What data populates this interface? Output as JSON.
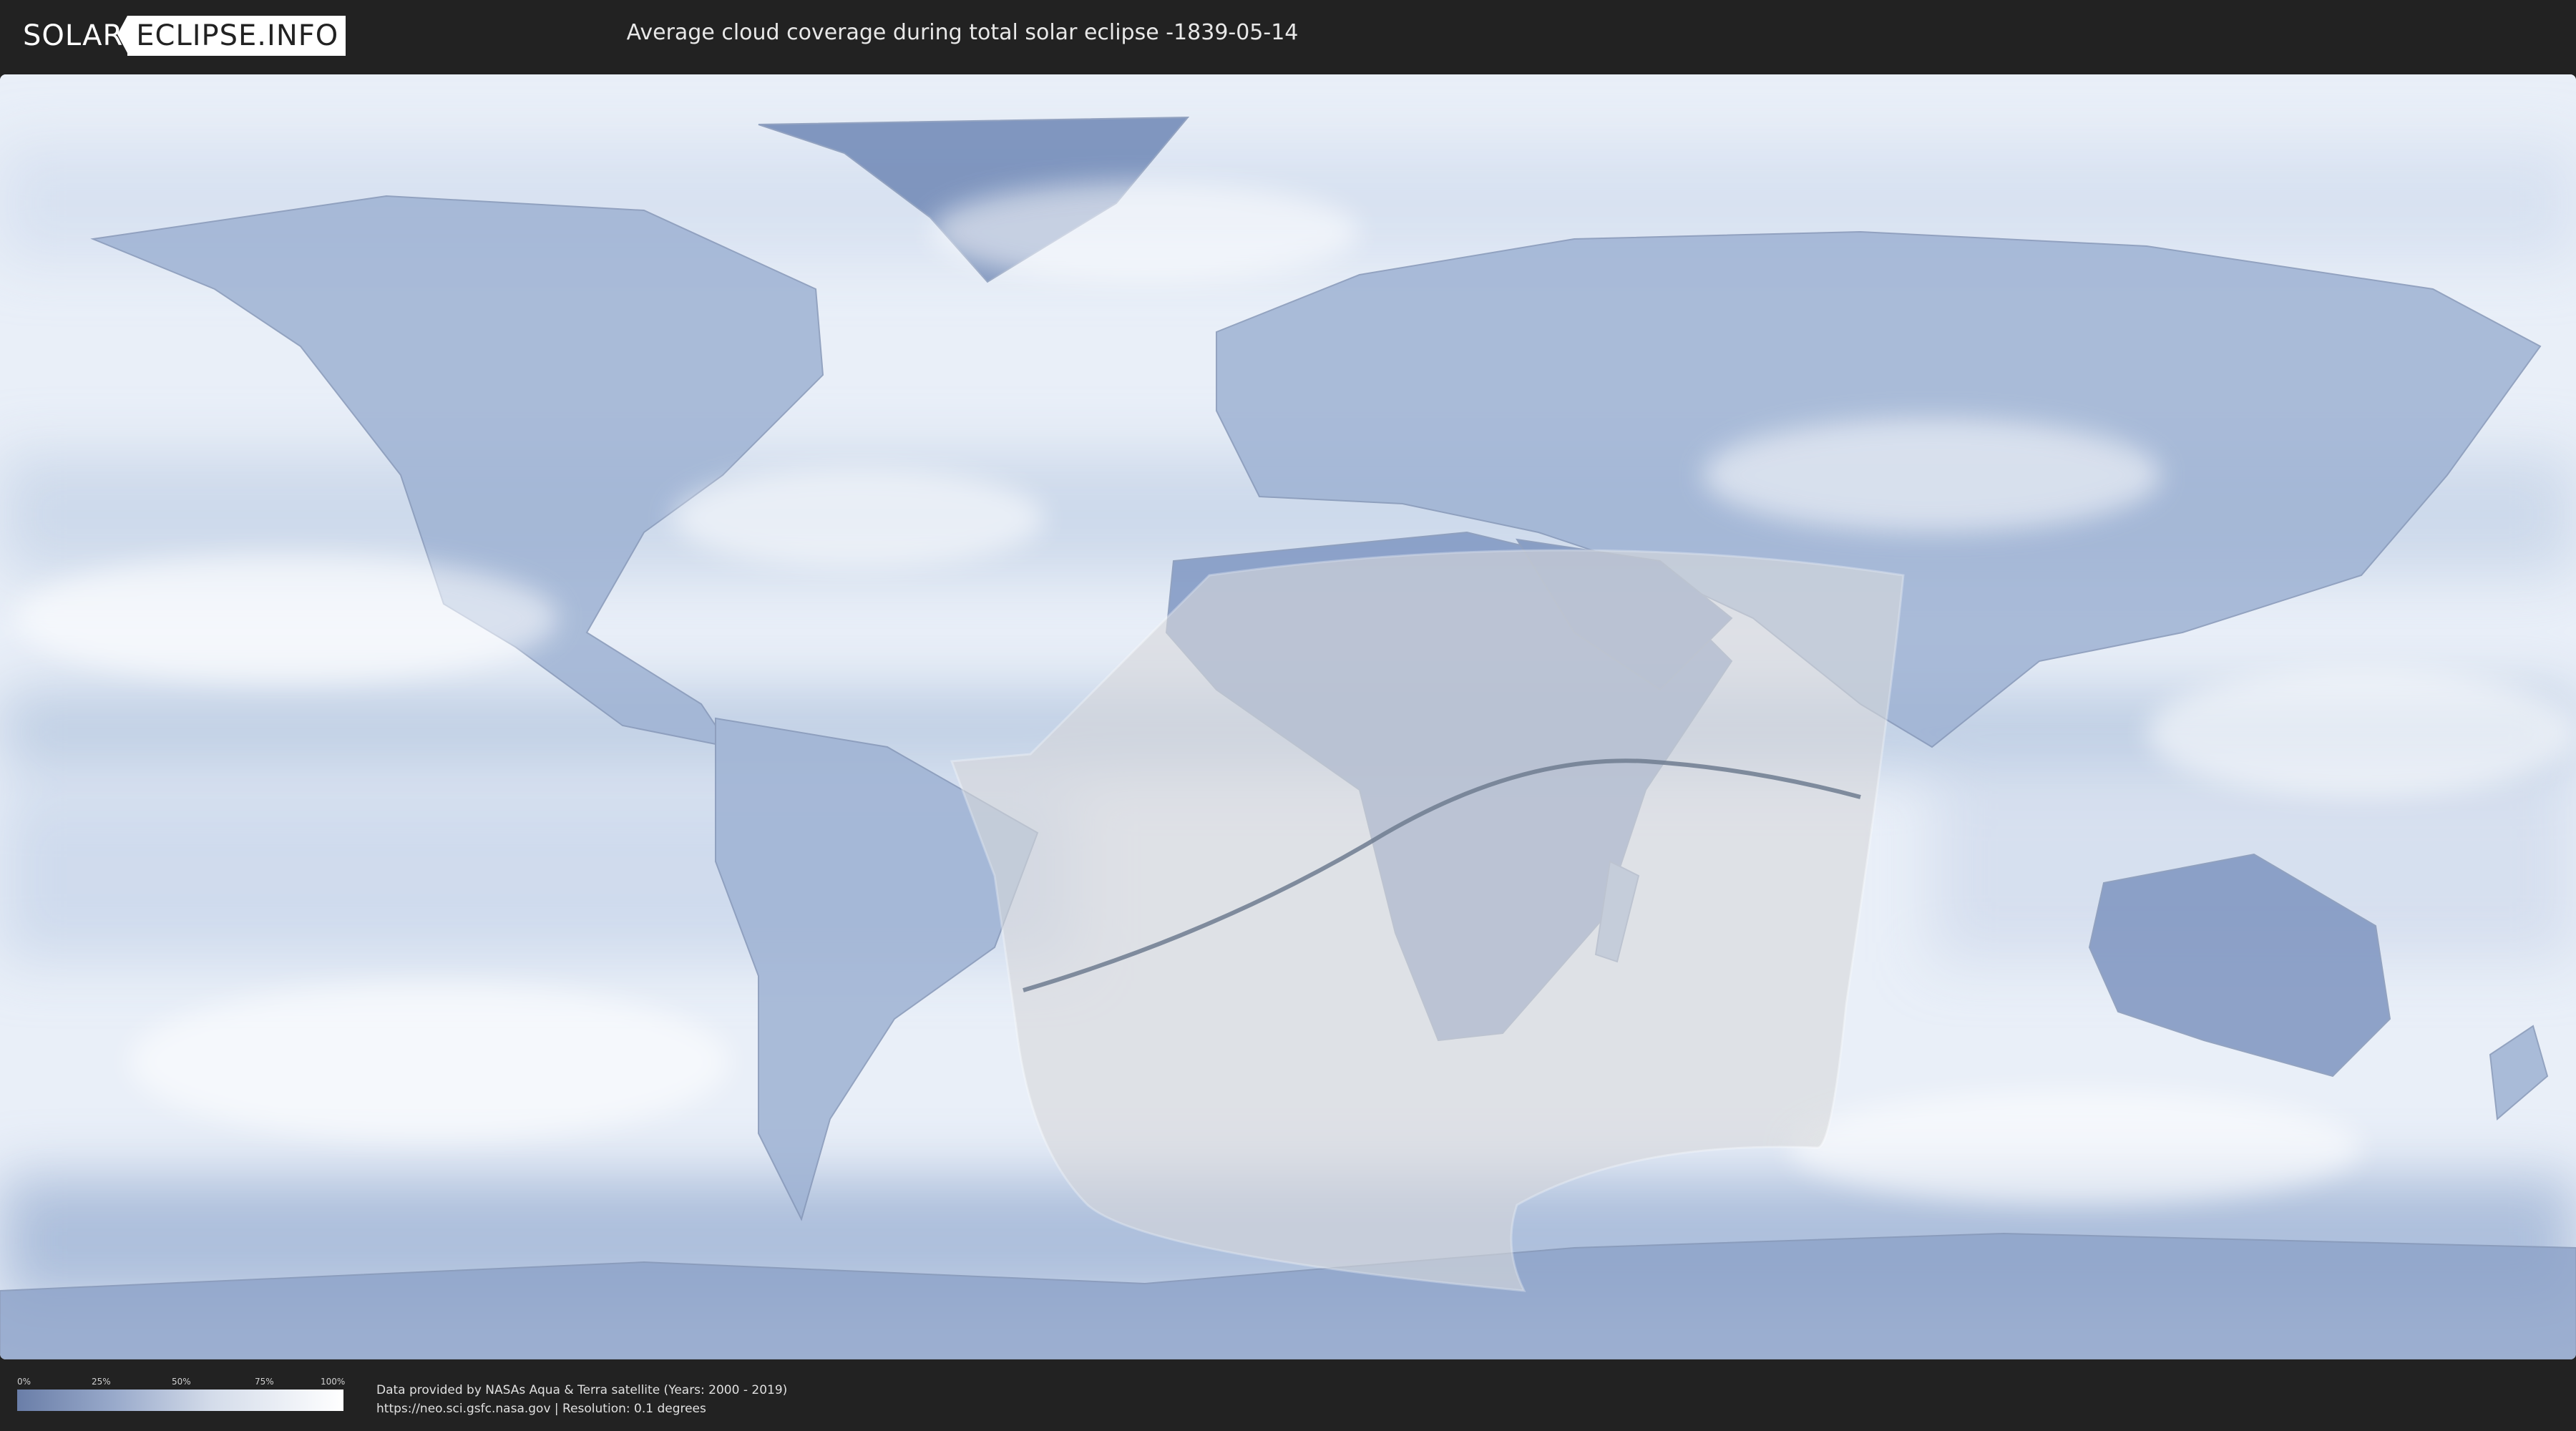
{
  "header": {
    "logo_solar": "SOLAR",
    "logo_eclipse": "ECLIPSE.INFO",
    "title": "Average cloud coverage during total solar eclipse -1839-05-14"
  },
  "legend": {
    "ticks": [
      "0%",
      "25%",
      "50%",
      "75%",
      "100%"
    ],
    "colors": [
      "#6a7ea8",
      "#99aacb",
      "#d4dcea",
      "#ffffff"
    ]
  },
  "footer": {
    "credit_line1": "Data provided by NASAs Aqua & Terra satellite (Years: 2000 - 2019)",
    "credit_line2": "https://neo.sci.gsfc.nasa.gov | Resolution: 0.1 degrees"
  },
  "map": {
    "projection": "equirectangular",
    "layer": "average-cloud-coverage",
    "eclipse_date": "-1839-05-14"
  }
}
